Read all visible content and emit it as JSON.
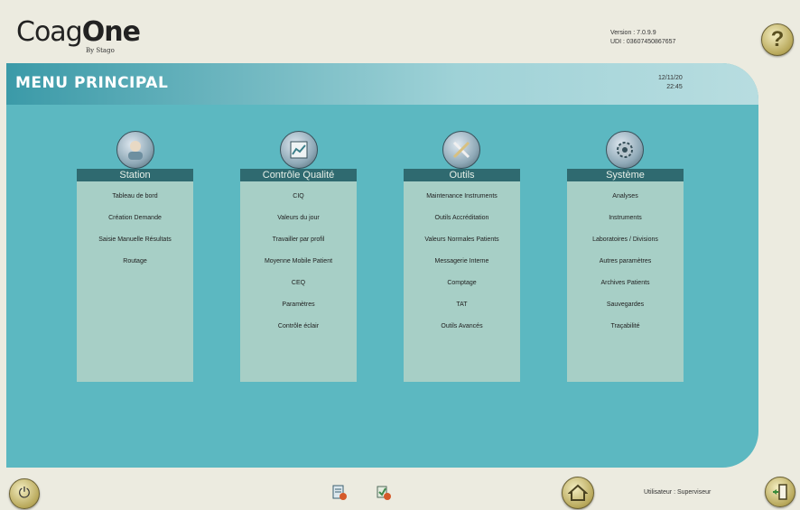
{
  "logo": {
    "text_pre": "Coag",
    "text_bold": "One",
    "sub": "By Stago"
  },
  "version": {
    "line1": "Version : 7.0.9.9",
    "line2": "UDI : 03607450867657"
  },
  "header": {
    "title": "MENU PRINCIPAL",
    "date": "12/11/20",
    "time": "22:45"
  },
  "columns": [
    {
      "title": "Station",
      "icon": "station-icon",
      "items": [
        "Tableau de bord",
        "Création Demande",
        "Saisie Manuelle Résultats",
        "Routage"
      ]
    },
    {
      "title": "Contrôle Qualité",
      "icon": "quality-control-icon",
      "items": [
        "CIQ",
        "Valeurs du jour",
        "Travailler par profil",
        "Moyenne Mobile Patient",
        "CEQ",
        "Paramètres",
        "Contrôle éclair"
      ]
    },
    {
      "title": "Outils",
      "icon": "tools-icon",
      "items": [
        "Maintenance Instruments",
        "Outils Accréditation",
        "Valeurs Normales Patients",
        "Messagerie Interne",
        "Comptage",
        "TAT",
        "Outils Avancés"
      ]
    },
    {
      "title": "Système",
      "icon": "system-gear-icon",
      "items": [
        "Analyses",
        "Instruments",
        "Laboratoires / Divisions",
        "Autres paramètres",
        "Archives Patients",
        "Sauvegardes",
        "Traçabilité"
      ]
    }
  ],
  "footer": {
    "user": "Utilisateur : Superviseur",
    "help": "?",
    "power": "⏻"
  }
}
